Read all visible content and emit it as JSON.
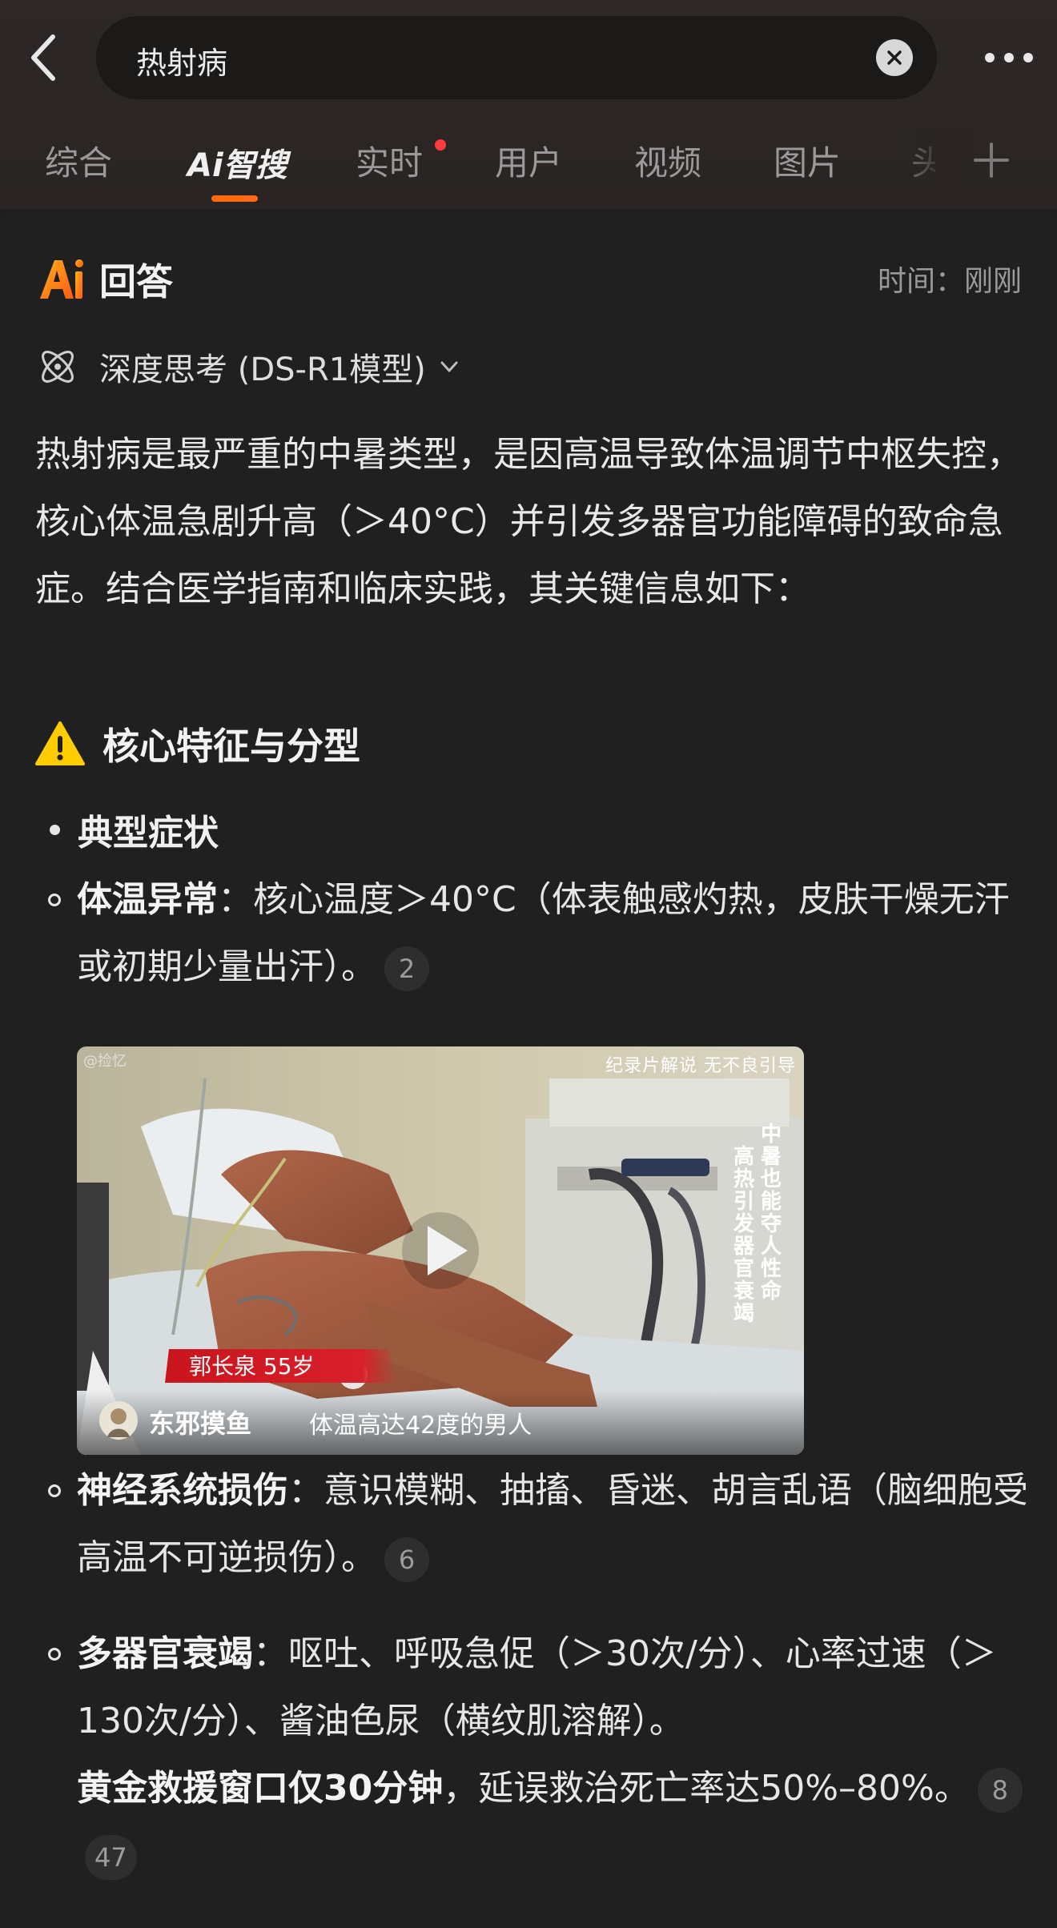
{
  "search": {
    "query": "热射病"
  },
  "tabs": [
    {
      "label": "综合"
    },
    {
      "label": "智搜",
      "prefix": "Ai"
    },
    {
      "label": "实时"
    },
    {
      "label": "用户"
    },
    {
      "label": "视频"
    },
    {
      "label": "图片"
    },
    {
      "label": "头"
    }
  ],
  "answer": {
    "title": "回答",
    "time": "时间：刚刚",
    "thinking_mode": "深度思考 (DS-R1模型)",
    "intro": "热射病是最严重的中暑类型，是因高温导致体温调节中枢失控，核心体温急剧升高（＞40°C）并引发多器官功能障碍的致命急症。结合医学指南和临床实践，其关键信息如下：",
    "section_title": "核心特征与分型",
    "bullet": "典型症状",
    "items": [
      {
        "label": "体温异常",
        "sep": "：",
        "text": "核心温度＞40°C（体表触感灼热，皮肤干燥无汗或初期少量出汗）。",
        "refs": [
          "2"
        ]
      },
      {
        "label": "神经系统损伤",
        "sep": "：",
        "text": "意识模糊、抽搐、昏迷、胡言乱语（脑细胞受高温不可逆损伤）。",
        "refs": [
          "6"
        ]
      },
      {
        "label": "多器官衰竭",
        "sep": "：",
        "text": "呕吐、呼吸急促（＞30次/分）、心率过速（＞130次/分）、酱油色尿（横纹肌溶解）。",
        "bold2": "黄金救援窗口仅30分钟",
        "text2": "，延误救治死亡率达50%–80%。",
        "refs": [
          "8",
          "47"
        ]
      }
    ]
  },
  "video": {
    "watermark": "@捡忆",
    "top_caption": "纪录片解说 无不良引导",
    "side_caption_1": "中暑也能夺人性命",
    "side_caption_2": "高热引发器官衰竭",
    "name_tag": "郭长泉  55岁",
    "author": "东邪摸鱼",
    "subtitle": "体温高达42度的男人"
  },
  "colors": {
    "accent": "#ff6a12",
    "background": "#1f1f1f",
    "header": "#2a2524",
    "notification_dot": "#ff3b3b"
  }
}
